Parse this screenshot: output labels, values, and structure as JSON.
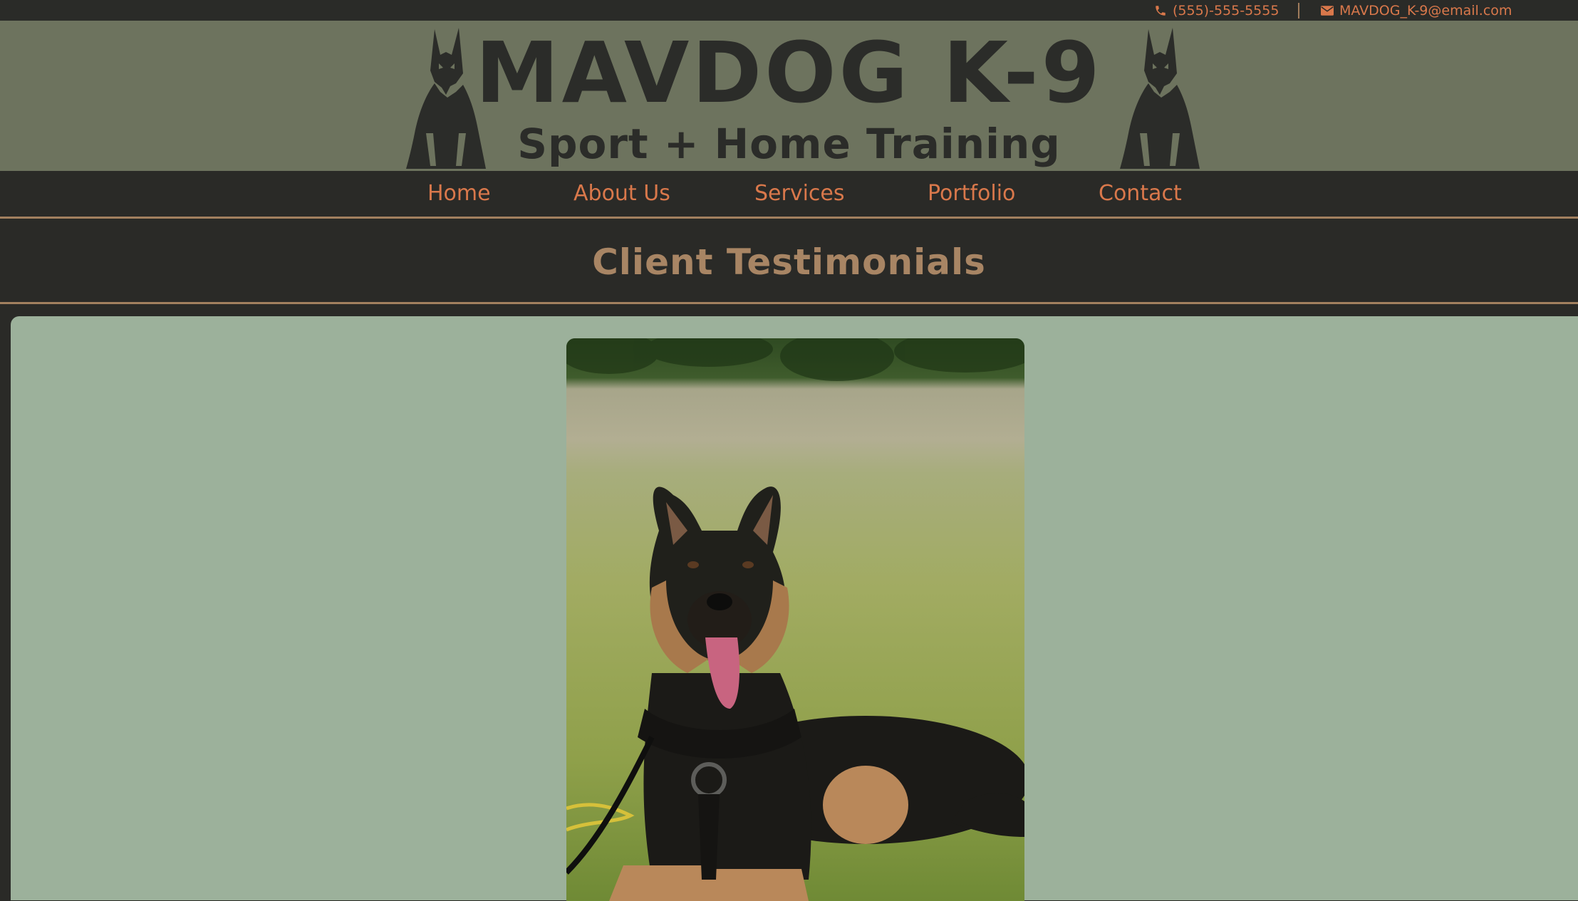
{
  "topbar": {
    "phone": "(555)-555-5555",
    "email": "MAVDOG_K-9@email.com",
    "phone_icon": "phone-icon",
    "email_icon": "envelope-icon"
  },
  "header": {
    "title": "MAVDOG K-9",
    "subtitle": "Sport + Home Training",
    "logo_icon": "doberman-silhouette"
  },
  "nav": {
    "items": [
      {
        "label": "Home"
      },
      {
        "label": "About Us"
      },
      {
        "label": "Services"
      },
      {
        "label": "Portfolio"
      },
      {
        "label": "Contact"
      }
    ]
  },
  "section": {
    "title": "Client Testimonials"
  },
  "colors": {
    "accent": "#d9784b",
    "header_bg": "#6d735e",
    "dark_bg": "#2a2a27",
    "content_bg": "#9cb19b",
    "heading": "#a88564",
    "rule": "#a2805f"
  }
}
